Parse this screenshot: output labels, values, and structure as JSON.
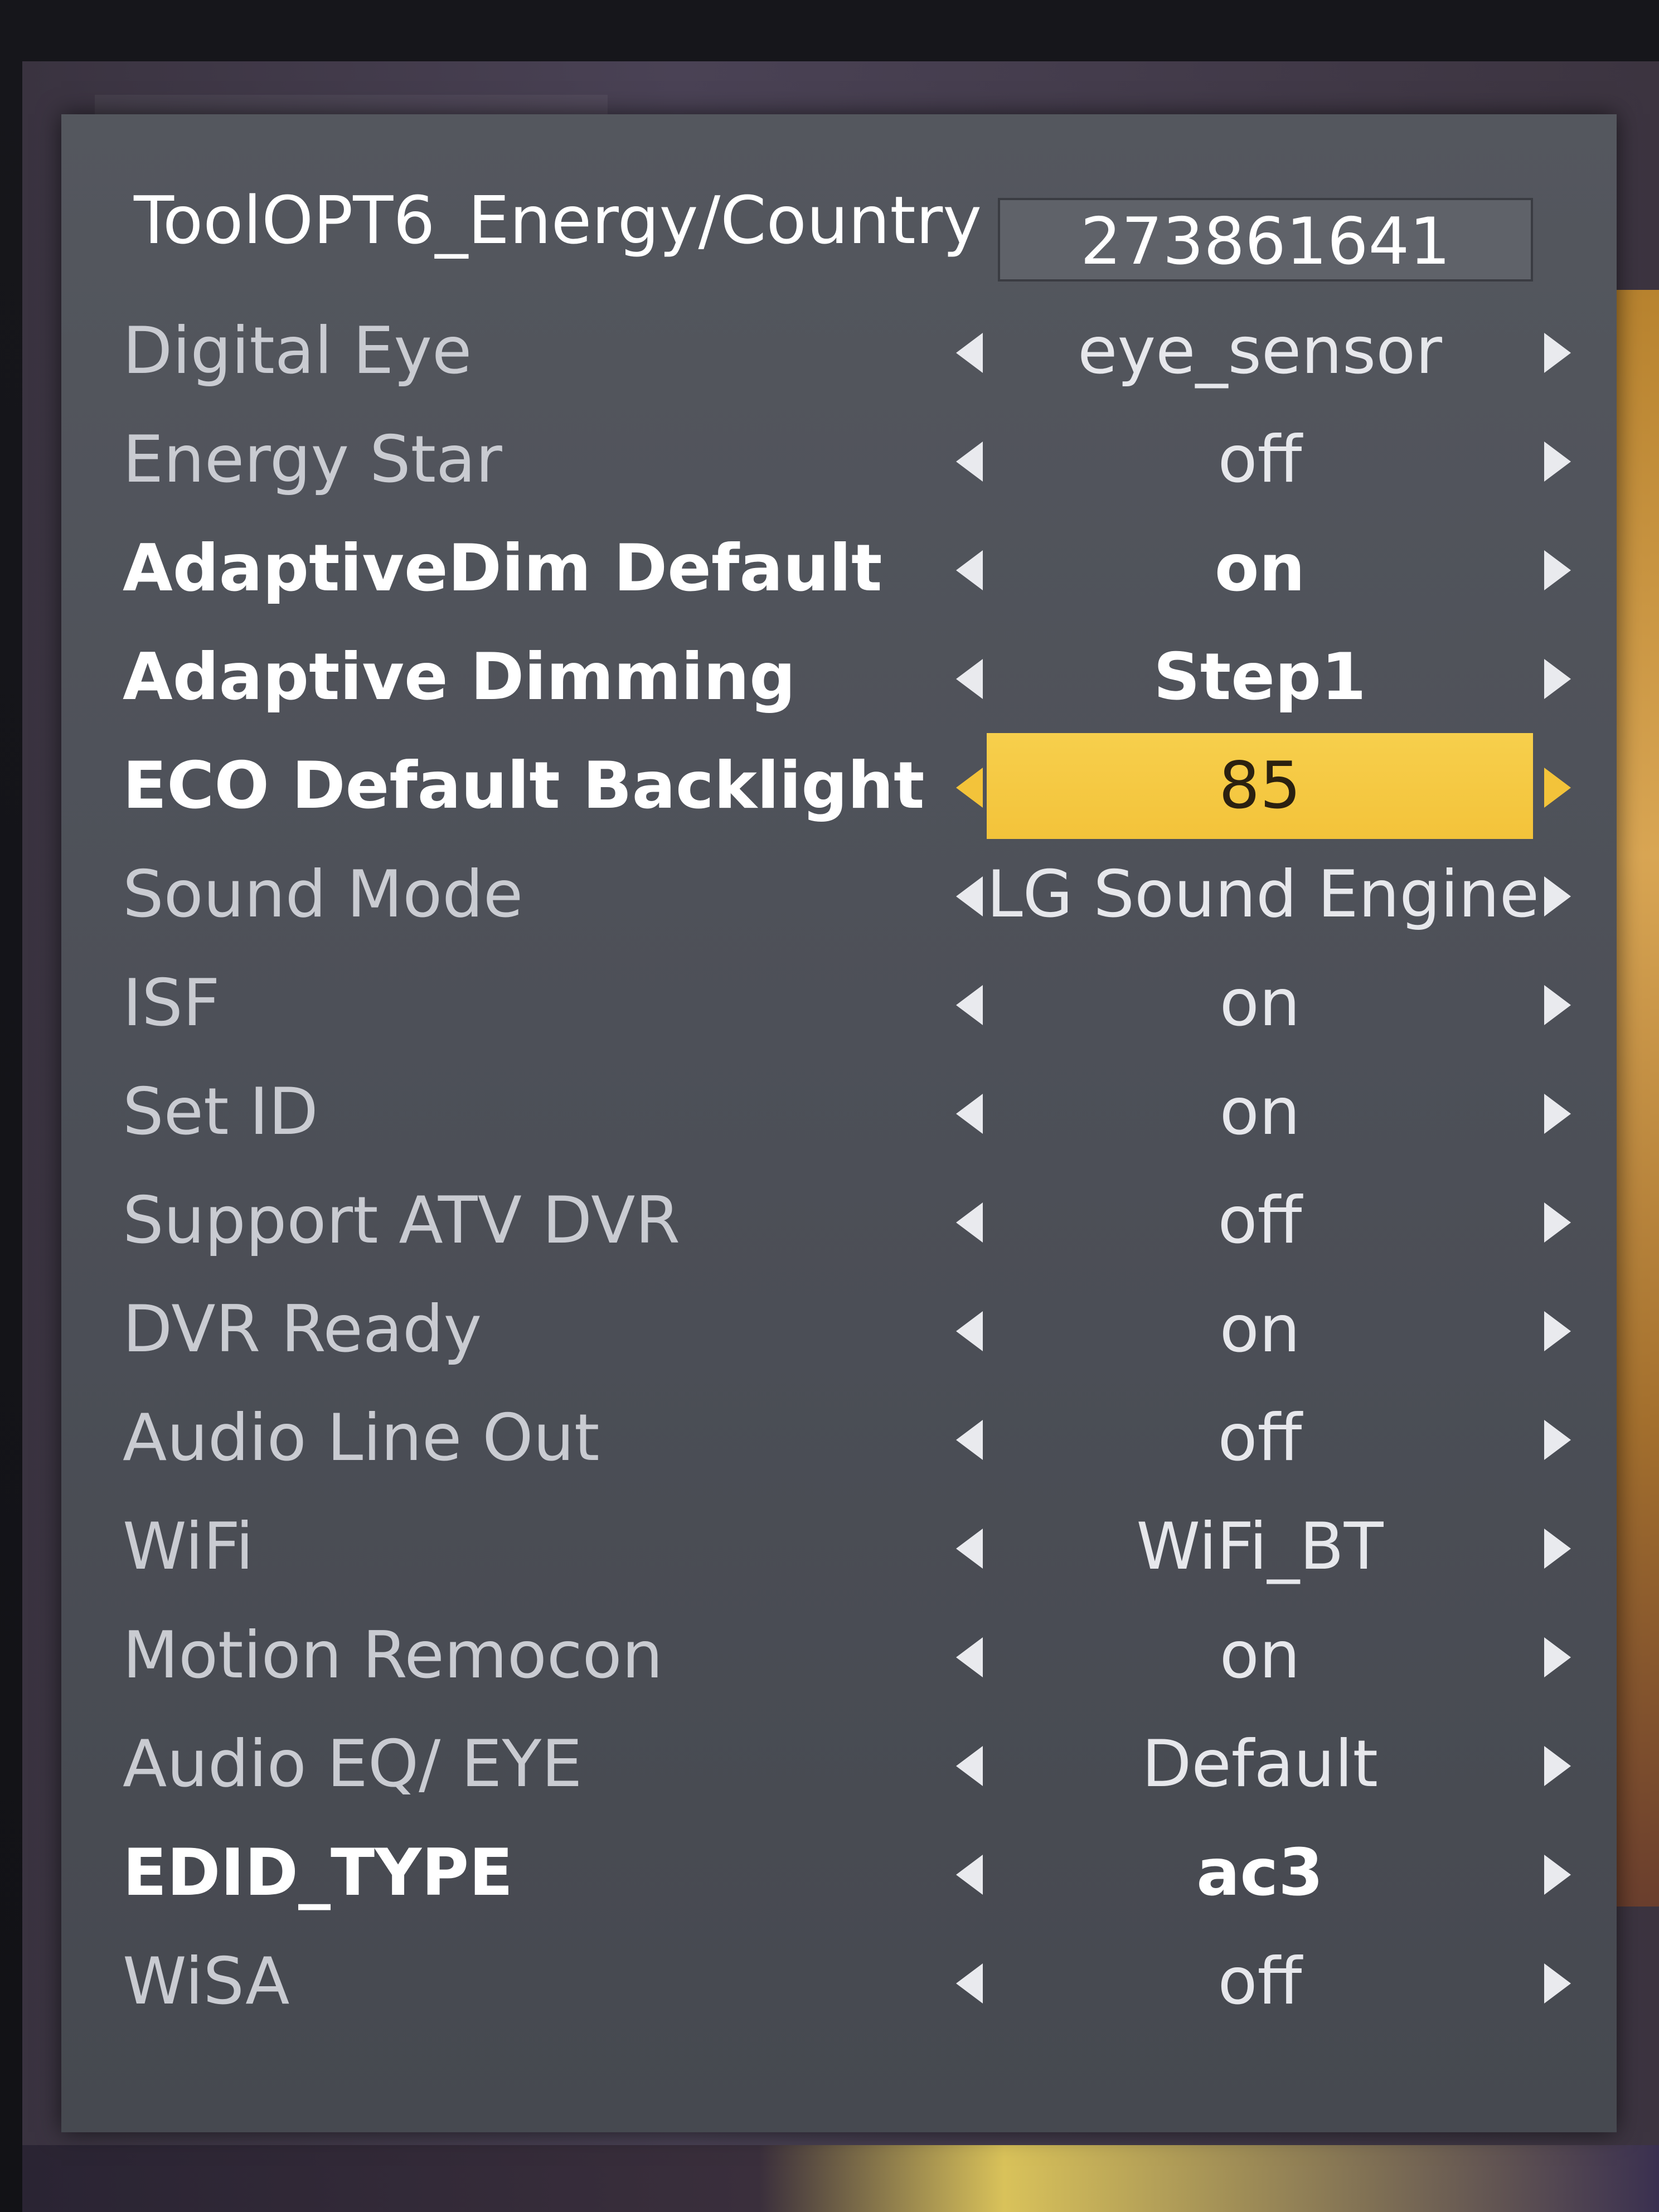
{
  "header": {
    "title": "ToolOPT6_Energy/Country",
    "value": "273861641"
  },
  "menu": {
    "items": [
      {
        "label": "Digital Eye",
        "value": "eye_sensor",
        "emphasis": false,
        "selected": false
      },
      {
        "label": "Energy Star",
        "value": "off",
        "emphasis": false,
        "selected": false
      },
      {
        "label": "AdaptiveDim Default",
        "value": "on",
        "emphasis": true,
        "selected": false
      },
      {
        "label": "Adaptive Dimming",
        "value": "Step1",
        "emphasis": true,
        "selected": false
      },
      {
        "label": "ECO Default Backlight",
        "value": "85",
        "emphasis": true,
        "selected": true
      },
      {
        "label": "Sound Mode",
        "value": "LG Sound Engine",
        "emphasis": false,
        "selected": false
      },
      {
        "label": "ISF",
        "value": "on",
        "emphasis": false,
        "selected": false
      },
      {
        "label": "Set ID",
        "value": "on",
        "emphasis": false,
        "selected": false
      },
      {
        "label": "Support ATV DVR",
        "value": "off",
        "emphasis": false,
        "selected": false
      },
      {
        "label": "DVR Ready",
        "value": "on",
        "emphasis": false,
        "selected": false
      },
      {
        "label": "Audio Line Out",
        "value": "off",
        "emphasis": false,
        "selected": false
      },
      {
        "label": "WiFi",
        "value": "WiFi_BT",
        "emphasis": false,
        "selected": false
      },
      {
        "label": "Motion Remocon",
        "value": "on",
        "emphasis": false,
        "selected": false
      },
      {
        "label": "Audio EQ/ EYE",
        "value": "Default",
        "emphasis": false,
        "selected": false
      },
      {
        "label": "EDID_TYPE",
        "value": "ac3",
        "emphasis": true,
        "selected": false
      },
      {
        "label": "WiSA",
        "value": "off",
        "emphasis": false,
        "selected": false
      }
    ]
  },
  "icons": {
    "left": "chevron-left-icon",
    "right": "chevron-right-icon"
  },
  "colors": {
    "panel": "#4d5058",
    "highlight": "#f3c33a",
    "text_dim": "#c9cbd1",
    "text_bright": "#ffffff"
  }
}
